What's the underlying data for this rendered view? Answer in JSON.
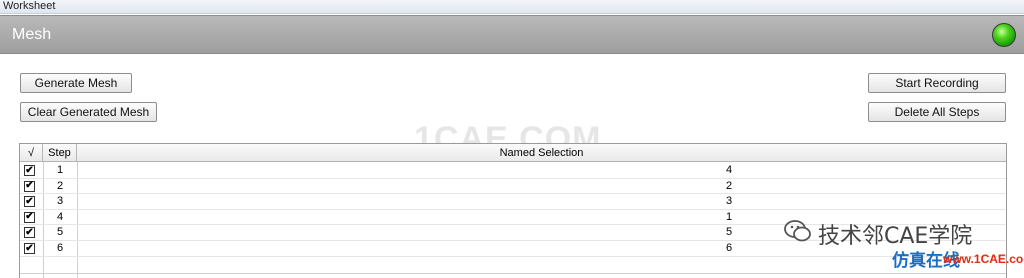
{
  "window": {
    "title": "Worksheet"
  },
  "header": {
    "title": "Mesh",
    "status": "green"
  },
  "buttons": {
    "generate_mesh": "Generate Mesh",
    "clear_generated_mesh": "Clear Generated Mesh",
    "start_recording": "Start Recording",
    "delete_all_steps": "Delete All Steps"
  },
  "watermark": "1CAE.COM",
  "table": {
    "columns": {
      "check": "√",
      "step": "Step",
      "named_selection": "Named Selection"
    },
    "rows": [
      {
        "step": "1",
        "named_selection": "4",
        "checked": true
      },
      {
        "step": "2",
        "named_selection": "2",
        "checked": true
      },
      {
        "step": "3",
        "named_selection": "3",
        "checked": true
      },
      {
        "step": "4",
        "named_selection": "1",
        "checked": true
      },
      {
        "step": "5",
        "named_selection": "5",
        "checked": true
      },
      {
        "step": "6",
        "named_selection": "6",
        "checked": true
      }
    ]
  },
  "branding": {
    "name": "技术邻CAE学院",
    "sub": "仿真在线",
    "url": "www.1CAE.com"
  },
  "colors": {
    "header_bg": "#a8a8a8",
    "status_light": "#2fbf10",
    "brand_blue": "#1a6fc0",
    "brand_red": "#e52a12"
  }
}
